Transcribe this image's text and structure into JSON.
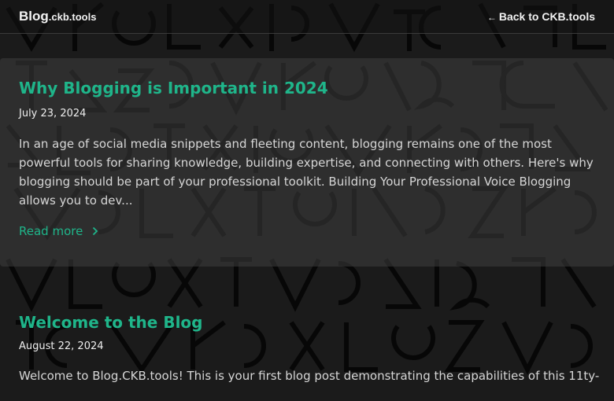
{
  "header": {
    "brand_main": "Blog",
    "brand_sub": ".ckb.tools",
    "back_label": "Back to CKB.tools"
  },
  "posts": [
    {
      "title": "Why Blogging is Important in 2024",
      "date": "July 23, 2024",
      "excerpt": "In an age of social media snippets and fleeting content, blogging remains one of the most powerful tools for sharing knowledge, building expertise, and connecting with others. Here's why blogging should be part of your professional toolkit. Building Your Professional Voice Blogging allows you to dev...",
      "read_more": "Read more"
    },
    {
      "title": "Welcome to the Blog",
      "date": "August 22, 2024",
      "excerpt": "Welcome to Blog.CKB.tools! This is your first blog post demonstrating the capabilities of this 11ty-"
    }
  ],
  "colors": {
    "accent": "#1fb58a",
    "background": "#1b1b1b",
    "card": "#3e3e3e",
    "text": "#d6d6d6"
  },
  "icons": {
    "back": "left-arrow-icon",
    "read_more": "chevron-right-icon"
  }
}
